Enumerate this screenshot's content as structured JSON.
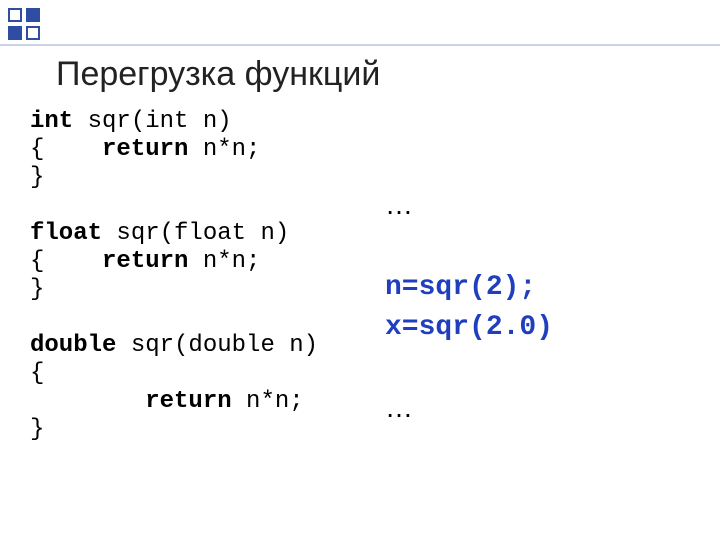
{
  "title": "Перегрузка функций",
  "left": {
    "fn1": {
      "ret": "int",
      "sig": " sqr(int n)",
      "open": "{    ",
      "ret_kw": "return",
      "expr": " n*n;",
      "close": "}"
    },
    "fn2": {
      "ret": "float",
      "sig": " sqr(float n)",
      "open": "{    ",
      "ret_kw": "return",
      "expr": " n*n;",
      "close": "}"
    },
    "fn3": {
      "ret": "double",
      "sig": " sqr(double n)",
      "open": "{",
      "indent": "        ",
      "ret_kw": "return",
      "expr": " n*n;",
      "close": "}"
    }
  },
  "right": {
    "ell1": "…",
    "call1": "n=sqr(2);",
    "call2": "x=sqr(2.0)",
    "ell2": "…"
  }
}
